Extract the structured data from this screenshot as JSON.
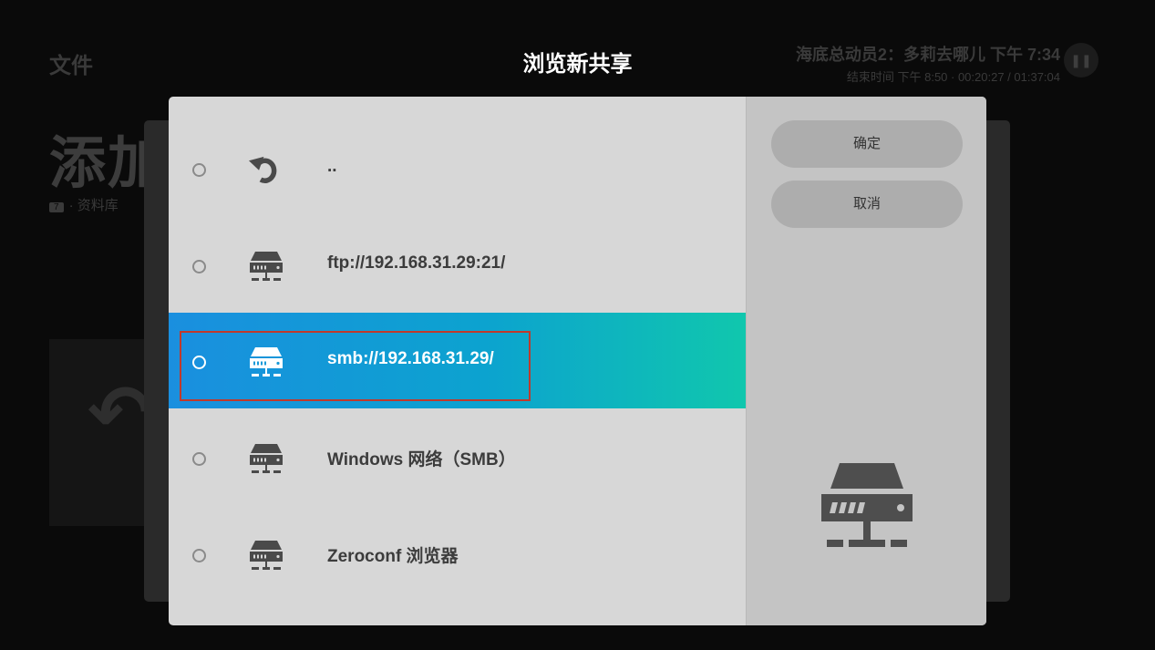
{
  "background": {
    "app_title": "文件",
    "heading": "添加",
    "subtitle_badge": "7",
    "subtitle": "· 资料库",
    "now_playing": {
      "title": "海底总动员2：多莉去哪儿",
      "clock": "下午 7:34",
      "subline": "结束时间 下午 8:50 · 00:20:27 / 01:37:04",
      "pause_icon": "pause-icon"
    }
  },
  "dialog": {
    "title": "浏览新共享",
    "items": [
      {
        "label": "..",
        "icon": "back-arrow-icon",
        "selected": false
      },
      {
        "label": "ftp://192.168.31.29:21/",
        "icon": "network-drive-icon",
        "selected": false
      },
      {
        "label": "smb://192.168.31.29/",
        "icon": "network-drive-icon",
        "selected": true
      },
      {
        "label": "Windows 网络（SMB）",
        "icon": "network-drive-icon",
        "selected": false
      },
      {
        "label": "Zeroconf 浏览器",
        "icon": "network-drive-icon",
        "selected": false
      }
    ],
    "buttons": {
      "ok": "确定",
      "cancel": "取消"
    },
    "side_icon": "network-drive-icon"
  },
  "colors": {
    "selected_gradient_start": "#1a8fdf",
    "selected_gradient_end": "#10c7ad",
    "focus_outline": "#c0392b",
    "dialog_bg": "#d7d7d7",
    "side_bg": "#c4c4c4"
  }
}
